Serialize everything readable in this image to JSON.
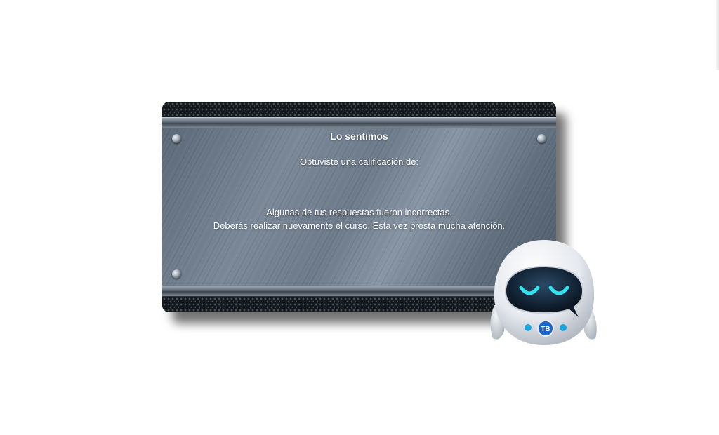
{
  "dialog": {
    "title": "Lo sentimos",
    "score_label": "Obtuviste una calificación de:",
    "message_line1": "Algunas de tus respuestas fueron incorrectas.",
    "message_line2": "Deberás realizar nuevamente el curso. Esta vez presta mucha atención."
  },
  "mascot": {
    "icon": "robot-mascot-icon",
    "badge": "TB",
    "accent_color": "#18a8e0",
    "eye_color": "#31e3ee"
  },
  "colors": {
    "background": "#ffffff",
    "panel_metal": "#6c7a8a",
    "text": "#ffffff"
  }
}
